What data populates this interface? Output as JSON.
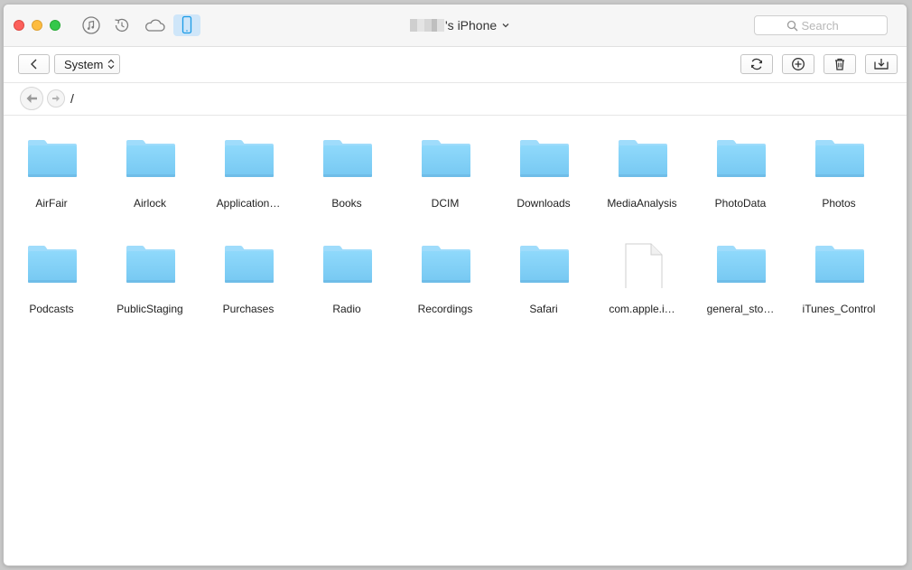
{
  "window": {
    "device_name_suffix": "'s iPhone"
  },
  "titlebar": {
    "nav_icons": [
      {
        "name": "music-icon"
      },
      {
        "name": "restore-icon"
      },
      {
        "name": "cloud-icon"
      },
      {
        "name": "iphone-icon",
        "active": true
      }
    ],
    "search": {
      "placeholder": "Search",
      "value": ""
    }
  },
  "toolbar": {
    "location_select": "System",
    "actions": [
      "refresh-icon",
      "add-icon",
      "trash-icon",
      "export-to-computer-icon"
    ]
  },
  "pathbar": {
    "path": "/"
  },
  "files": {
    "items": [
      {
        "label": "AirFair",
        "type": "folder"
      },
      {
        "label": "Airlock",
        "type": "folder"
      },
      {
        "label": "Application…",
        "type": "folder"
      },
      {
        "label": "Books",
        "type": "folder"
      },
      {
        "label": "DCIM",
        "type": "folder"
      },
      {
        "label": "Downloads",
        "type": "folder"
      },
      {
        "label": "MediaAnalysis",
        "type": "folder"
      },
      {
        "label": "PhotoData",
        "type": "folder"
      },
      {
        "label": "Photos",
        "type": "folder"
      },
      {
        "label": "Podcasts",
        "type": "folder"
      },
      {
        "label": "PublicStaging",
        "type": "folder"
      },
      {
        "label": "Purchases",
        "type": "folder"
      },
      {
        "label": "Radio",
        "type": "folder"
      },
      {
        "label": "Recordings",
        "type": "folder"
      },
      {
        "label": "Safari",
        "type": "folder"
      },
      {
        "label": "com.apple.i…",
        "type": "file"
      },
      {
        "label": "general_sto…",
        "type": "folder"
      },
      {
        "label": "iTunes_Control",
        "type": "folder"
      }
    ]
  },
  "colors": {
    "folder_top": "#8fd9fb",
    "folder_bottom": "#76c8f2",
    "active_tab": "#cfe6f9",
    "accent": "#1a9be6"
  }
}
